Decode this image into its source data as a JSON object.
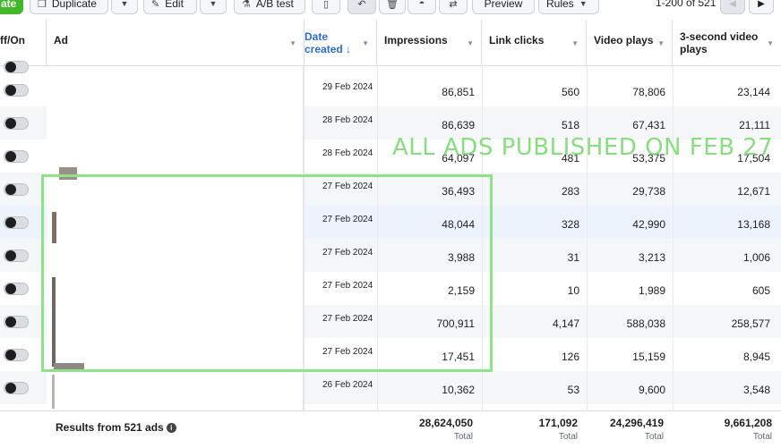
{
  "toolbar": {
    "create_label": "ate",
    "duplicate_label": "Duplicate",
    "edit_label": "Edit",
    "ab_test_label": "A/B test",
    "preview_label": "Preview",
    "rules_label": "Rules",
    "pager_text": "1-200 of 521",
    "icons": [
      "copy-icon",
      "pencil-icon",
      "flask-icon",
      "clipboard-icon",
      "undo-icon",
      "trash-icon",
      "speedometer-icon",
      "transfer-icon"
    ]
  },
  "table": {
    "headers": {
      "onoff": "ff/On",
      "ad": "Ad",
      "date_line1": "Date",
      "date_line2": "created ↓",
      "impressions": "Impressions",
      "link_clicks": "Link clicks",
      "video_plays": "Video plays",
      "three_sec_line1": "3-second video",
      "three_sec_line2": "plays"
    },
    "rows": [
      {
        "date": "29 Feb 2024",
        "impressions": "86,851",
        "link_clicks": "560",
        "video_plays": "78,806",
        "three_sec": "23,144"
      },
      {
        "date": "28 Feb 2024",
        "impressions": "86,639",
        "link_clicks": "518",
        "video_plays": "67,431",
        "three_sec": "21,111"
      },
      {
        "date": "28 Feb 2024",
        "impressions": "64,097",
        "link_clicks": "481",
        "video_plays": "53,375",
        "three_sec": "17,504"
      },
      {
        "date": "27 Feb 2024",
        "impressions": "36,493",
        "link_clicks": "283",
        "video_plays": "29,738",
        "three_sec": "12,671"
      },
      {
        "date": "27 Feb 2024",
        "impressions": "48,044",
        "link_clicks": "328",
        "video_plays": "42,990",
        "three_sec": "13,168"
      },
      {
        "date": "27 Feb 2024",
        "impressions": "3,988",
        "link_clicks": "31",
        "video_plays": "3,213",
        "three_sec": "1,006"
      },
      {
        "date": "27 Feb 2024",
        "impressions": "2,159",
        "link_clicks": "10",
        "video_plays": "1,989",
        "three_sec": "605"
      },
      {
        "date": "27 Feb 2024",
        "impressions": "700,911",
        "link_clicks": "4,147",
        "video_plays": "588,038",
        "three_sec": "258,577"
      },
      {
        "date": "27 Feb 2024",
        "impressions": "17,451",
        "link_clicks": "126",
        "video_plays": "15,159",
        "three_sec": "8,945"
      },
      {
        "date": "26 Feb 2024",
        "impressions": "10,362",
        "link_clicks": "53",
        "video_plays": "9,600",
        "three_sec": "3,548"
      }
    ],
    "footer": {
      "label": "Results from 521 ads",
      "impressions": "28,624,050",
      "link_clicks": "171,092",
      "video_plays": "24,296,419",
      "three_sec": "9,661,208",
      "total_label": "Total"
    }
  },
  "annotation": {
    "text": "ALL ADS PUBLISHED ON FEB 27",
    "color": "#7fdb76"
  },
  "colors": {
    "accent_blue": "#2d6ccb",
    "create_green": "#42b72a"
  }
}
